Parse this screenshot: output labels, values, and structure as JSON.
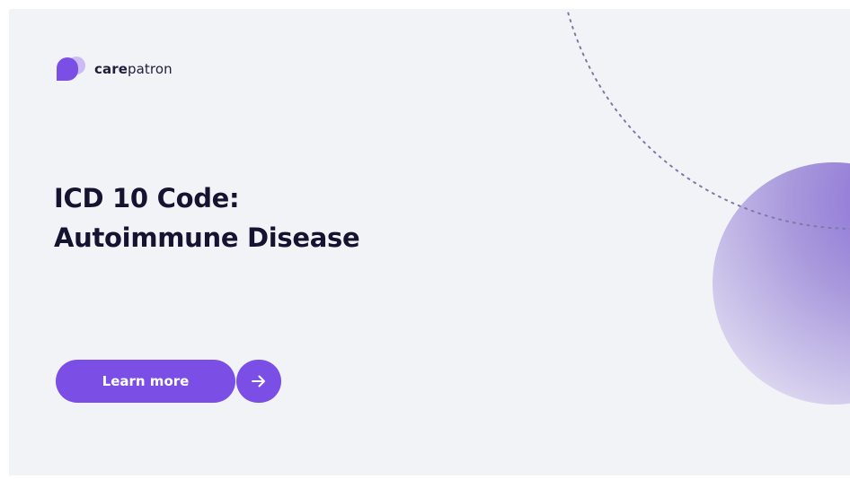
{
  "brand": {
    "name_bold": "care",
    "name_regular": "patron",
    "logo_icon": "carepatron-logo-icon"
  },
  "headline": {
    "line1": "ICD 10 Code:",
    "line2": "Autoimmune Disease"
  },
  "cta": {
    "label": "Learn more",
    "arrow_icon": "arrow-right-icon"
  },
  "colors": {
    "background": "#f2f3f7",
    "accent": "#7b4ee6",
    "heading": "#141330",
    "dotted_line": "#7d7aa6"
  }
}
